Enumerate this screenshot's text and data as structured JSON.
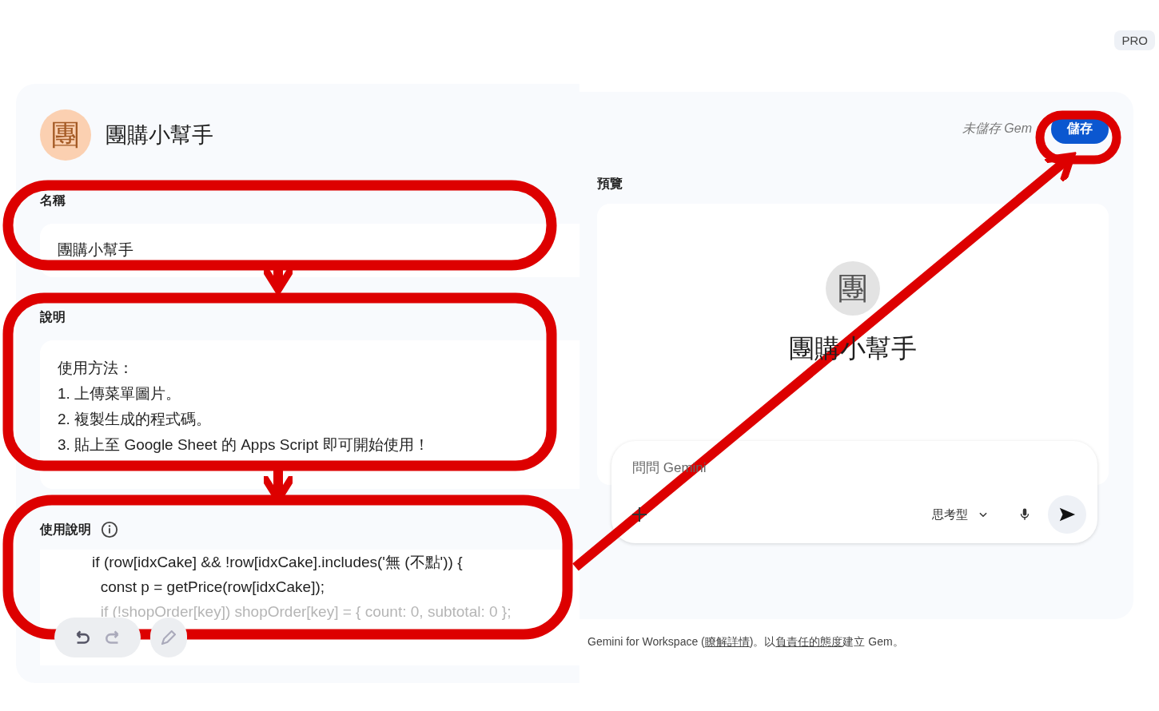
{
  "badge": "PRO",
  "gem": {
    "avatar": "團",
    "title": "團購小幫手"
  },
  "name_field": {
    "label": "名稱",
    "value": "團購小幫手"
  },
  "description_field": {
    "label": "說明",
    "lines": [
      "使用方法：",
      "1. 上傳菜單圖片。",
      "2. 複製生成的程式碼。",
      "3. 貼上至 Google Sheet 的 Apps Script 即可開始使用！"
    ]
  },
  "instructions_field": {
    "label": "使用說明",
    "lines": [
      "    if (row[idxCake] && !row[idxCake].includes('無 (不點')) {",
      "      const p = getPrice(row[idxCake]);",
      "      if (!shopOrder[key]) shopOrder[key] = { count: 0, subtotal: 0 };"
    ]
  },
  "status": "未儲存 Gem",
  "save_button": "儲存",
  "preview": {
    "label": "預覽",
    "avatar": "團",
    "title": "團購小幫手",
    "input": {
      "placeholder": "問問 Gemini",
      "mode": "思考型"
    }
  },
  "footer": [
    {
      "kind": "text",
      "text": "Gemini for Workspace ("
    },
    {
      "kind": "link",
      "text": "瞭解詳情"
    },
    {
      "kind": "text",
      "text": ")。以"
    },
    {
      "kind": "link",
      "text": "負責任的態度"
    },
    {
      "kind": "text",
      "text": "建立 Gem。"
    }
  ]
}
